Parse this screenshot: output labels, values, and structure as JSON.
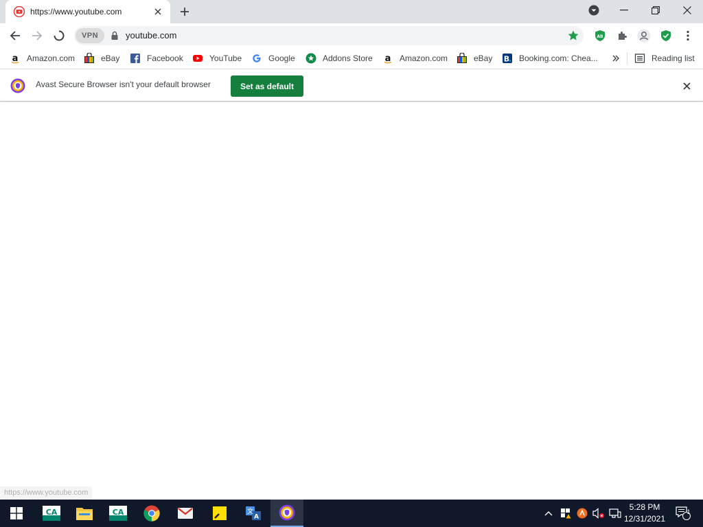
{
  "tab": {
    "title": "https://www.youtube.com"
  },
  "omnibox": {
    "vpn_label": "VPN",
    "url": "youtube.com"
  },
  "bookmarks": [
    {
      "label": "Amazon.com",
      "icon": "amazon-icon"
    },
    {
      "label": "eBay",
      "icon": "ebay-icon"
    },
    {
      "label": "Facebook",
      "icon": "facebook-icon"
    },
    {
      "label": "YouTube",
      "icon": "youtube-icon"
    },
    {
      "label": "Google",
      "icon": "google-icon"
    },
    {
      "label": "Addons Store",
      "icon": "addons-store-icon"
    },
    {
      "label": "Amazon.com",
      "icon": "amazon-icon"
    },
    {
      "label": "eBay",
      "icon": "ebay-icon"
    },
    {
      "label": "Booking.com: Chea...",
      "icon": "booking-icon"
    }
  ],
  "reading_list": {
    "label": "Reading list"
  },
  "infobar": {
    "message": "Avast Secure Browser isn't your default browser",
    "button_label": "Set as default"
  },
  "status_url": "https://www.youtube.com",
  "taskbar": {
    "time": "5:28 PM",
    "date": "12/31/2021",
    "notification_count": "1"
  },
  "colors": {
    "accent_green": "#15803d",
    "taskbar_bg": "#10192a",
    "titlebar_bg": "#dee1e6"
  }
}
